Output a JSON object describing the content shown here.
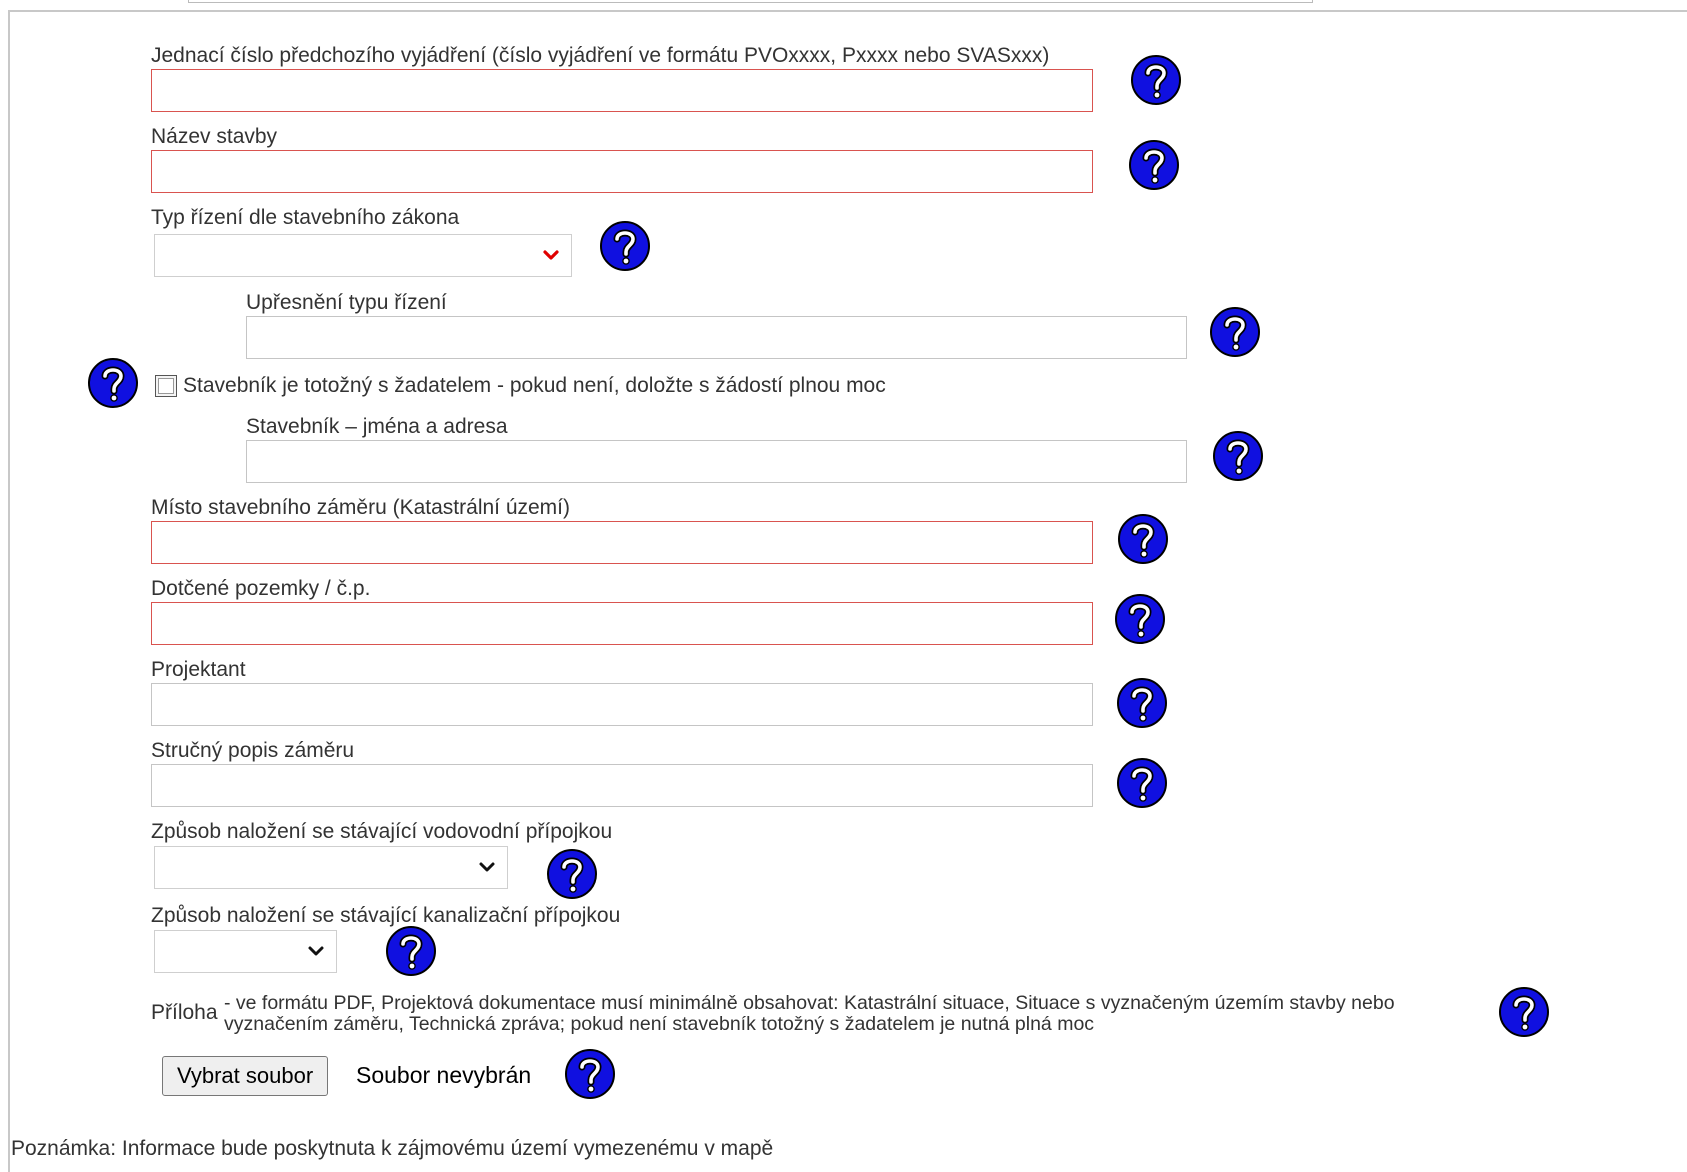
{
  "form": {
    "prev_statement": {
      "label": "Jednací číslo předchozího vyjádření (číslo vyjádření ve formátu PVOxxxx, Pxxxx nebo SVASxxx)",
      "value": ""
    },
    "building_name": {
      "label": "Název stavby",
      "value": ""
    },
    "procedure_type": {
      "label": "Typ řízení dle stavebního zákona",
      "selected": ""
    },
    "procedure_detail": {
      "label": "Upřesnění typu řízení",
      "value": ""
    },
    "builder_same": {
      "label": "Stavebník je totožný s žadatelem - pokud není, doložte s žádostí plnou moc",
      "checked": false
    },
    "builder_names": {
      "label": "Stavebník – jména a adresa",
      "value": ""
    },
    "location": {
      "label": "Místo stavebního záměru (Katastrální území)",
      "value": ""
    },
    "parcels": {
      "label": "Dotčené pozemky / č.p.",
      "value": ""
    },
    "designer": {
      "label": "Projektant",
      "value": ""
    },
    "description": {
      "label": "Stručný popis záměru",
      "value": ""
    },
    "water_connection": {
      "label": "Způsob naložení se stávající vodovodní přípojkou",
      "selected": ""
    },
    "sewer_connection": {
      "label": "Způsob naložení se stávající kanalizační přípojkou",
      "selected": ""
    },
    "attachment": {
      "label": "Příloha",
      "description": "- ve formátu PDF, Projektová dokumentace musí minimálně obsahovat: Katastrální situace, Situace s vyznačeným územím stavby nebo vyznačením záměru, Technická zpráva; pokud není stavebník totožný s žadatelem je nutná plná moc",
      "button_label": "Vybrat soubor",
      "status": "Soubor nevybrán"
    }
  },
  "note": "Poznámka: Informace bude poskytnuta k zájmovému území vymezenému v mapě",
  "colors": {
    "help_bg": "#1010e0",
    "required_border": "#d9534f",
    "text": "#333333"
  },
  "icons": {
    "help": "question-mark-circle",
    "select": "chevron-down"
  }
}
